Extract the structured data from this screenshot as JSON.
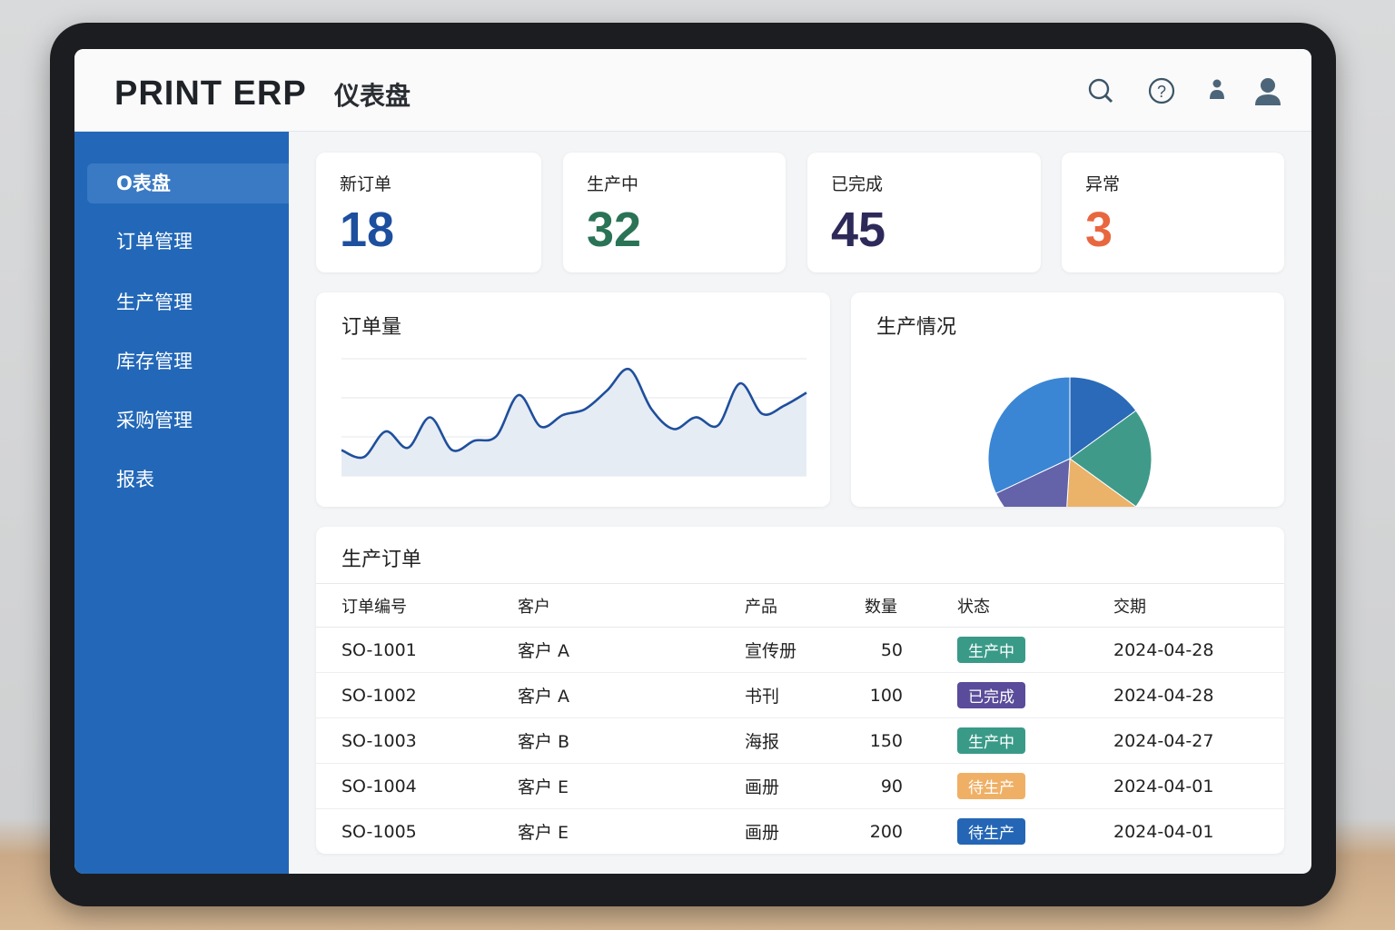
{
  "header": {
    "brand": "PRINT ERP",
    "page_title": "仪表盘",
    "icons": [
      "search-icon",
      "help-icon",
      "user-icon",
      "account-icon"
    ]
  },
  "sidebar": {
    "items": [
      {
        "label": "O表盘",
        "active": true
      },
      {
        "label": "订单管理"
      },
      {
        "label": "生产管理"
      },
      {
        "label": "库存管理"
      },
      {
        "label": "采购管理"
      },
      {
        "label": "报表"
      }
    ]
  },
  "stats": [
    {
      "label": "新订单",
      "value": "18",
      "color": "#1d4f9e"
    },
    {
      "label": "生产中",
      "value": "32",
      "color": "#2a7356"
    },
    {
      "label": "已完成",
      "value": "45",
      "color": "#2d2a5a"
    },
    {
      "label": "异常",
      "value": "3",
      "color": "#e8673f"
    }
  ],
  "line_card": {
    "title": "订单量"
  },
  "pie_card": {
    "title": "生产情况"
  },
  "chart_data": [
    {
      "type": "area",
      "title": "订单量",
      "ylim": [
        0,
        100
      ],
      "grid": true,
      "x": [
        0,
        1,
        2,
        3,
        4,
        5,
        6,
        7,
        8,
        9,
        10,
        11,
        12,
        13,
        14,
        15,
        16,
        17,
        18,
        19,
        20,
        21
      ],
      "values": [
        22,
        16,
        38,
        24,
        50,
        22,
        30,
        34,
        69,
        42,
        52,
        57,
        73,
        91,
        57,
        40,
        50,
        43,
        79,
        53,
        60,
        71
      ]
    },
    {
      "type": "pie",
      "title": "生产情况",
      "values": [
        15,
        20,
        16,
        17,
        32
      ],
      "colors": [
        "#2a6ab8",
        "#3f9a8a",
        "#ebb26a",
        "#6462a8",
        "#3a86d4"
      ]
    }
  ],
  "table": {
    "title": "生产订单",
    "columns": [
      "订单编号",
      "客户",
      "产品",
      "数量",
      "状态",
      "交期"
    ],
    "rows": [
      {
        "id": "SO-1001",
        "customer": "客户 A",
        "product": "宣传册",
        "qty": "50",
        "status": "生产中",
        "status_color": "#3a9a88",
        "due": "2024-04-28"
      },
      {
        "id": "SO-1002",
        "customer": "客户 A",
        "product": "书刊",
        "qty": "100",
        "status": "已完成",
        "status_color": "#5a4c9a",
        "due": "2024-04-28"
      },
      {
        "id": "SO-1003",
        "customer": "客户 B",
        "product": "海报",
        "qty": "150",
        "status": "生产中",
        "status_color": "#3a9a88",
        "due": "2024-04-27"
      },
      {
        "id": "SO-1004",
        "customer": "客户 E",
        "product": "画册",
        "qty": "90",
        "status": "待生产",
        "status_color": "#efb066",
        "due": "2024-04-01"
      },
      {
        "id": "SO-1005",
        "customer": "客户 E",
        "product": "画册",
        "qty": "200",
        "status": "待生产",
        "status_color": "#2466b5",
        "due": "2024-04-01"
      }
    ]
  }
}
